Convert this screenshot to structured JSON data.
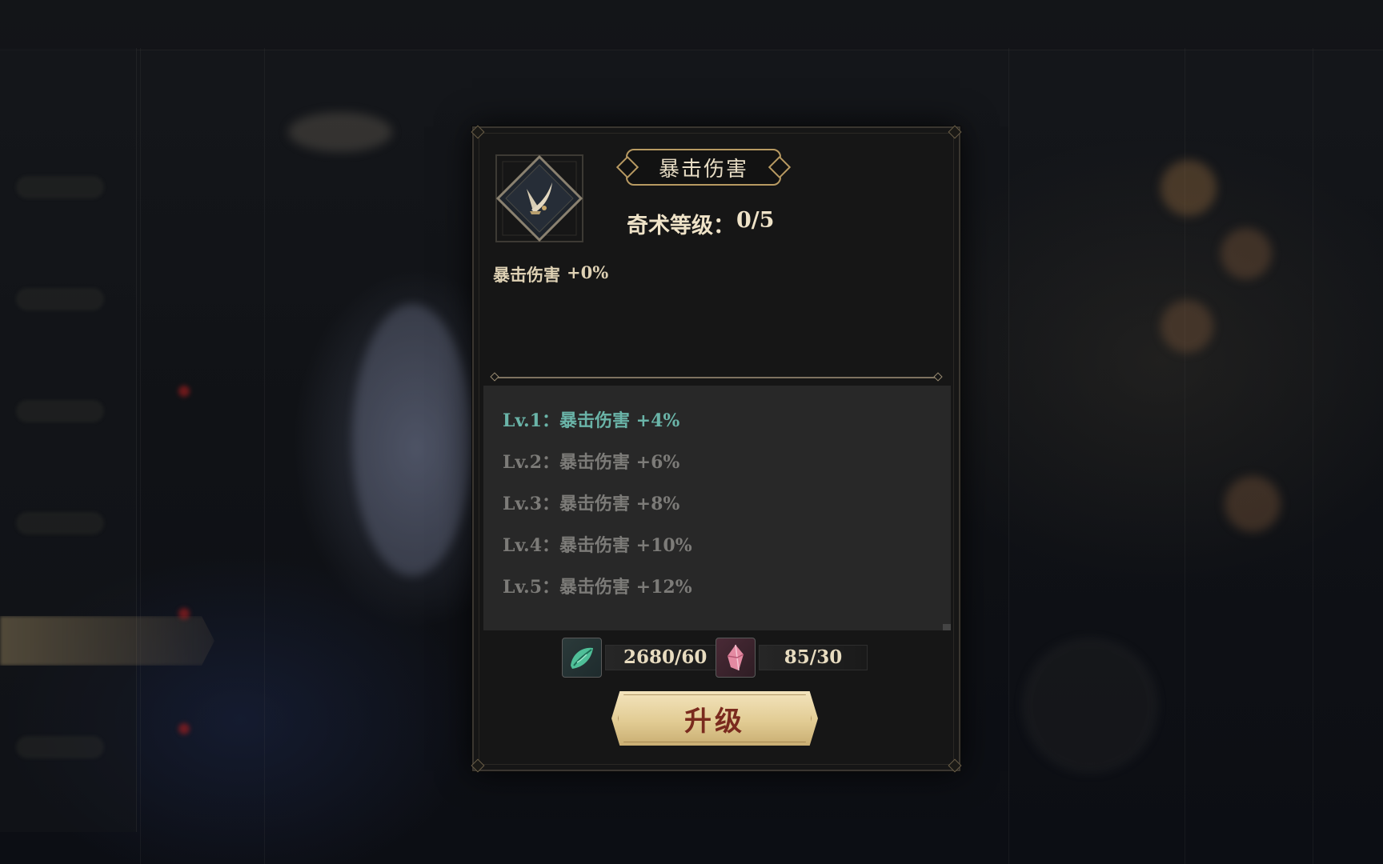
{
  "skill": {
    "name": "暴击伤害",
    "level_label": "奇术等级：",
    "level_value": "0/5",
    "current_effect_name": "暴击伤害",
    "current_effect_value": "+0%",
    "icon": "crossed-blades-icon"
  },
  "levels": [
    {
      "label": "Lv.1：",
      "effect": "暴击伤害 +4%",
      "state": "active"
    },
    {
      "label": "Lv.2：",
      "effect": "暴击伤害 +6%",
      "state": "locked"
    },
    {
      "label": "Lv.3：",
      "effect": "暴击伤害 +8%",
      "state": "locked"
    },
    {
      "label": "Lv.4：",
      "effect": "暴击伤害 +10%",
      "state": "locked"
    },
    {
      "label": "Lv.5：",
      "effect": "暴击伤害 +12%",
      "state": "locked"
    }
  ],
  "costs": [
    {
      "icon": "green-leaf-material-icon",
      "value": "2680/60"
    },
    {
      "icon": "pink-crystal-material-icon",
      "value": "85/30"
    }
  ],
  "upgrade_button": {
    "label": "升级"
  },
  "colors": {
    "panel_bg": "#161616",
    "gold_accent": "#b89a62",
    "active_level": "#6ab4a8",
    "locked_level": "#7c7b78",
    "button_text": "#7a2a1e"
  }
}
